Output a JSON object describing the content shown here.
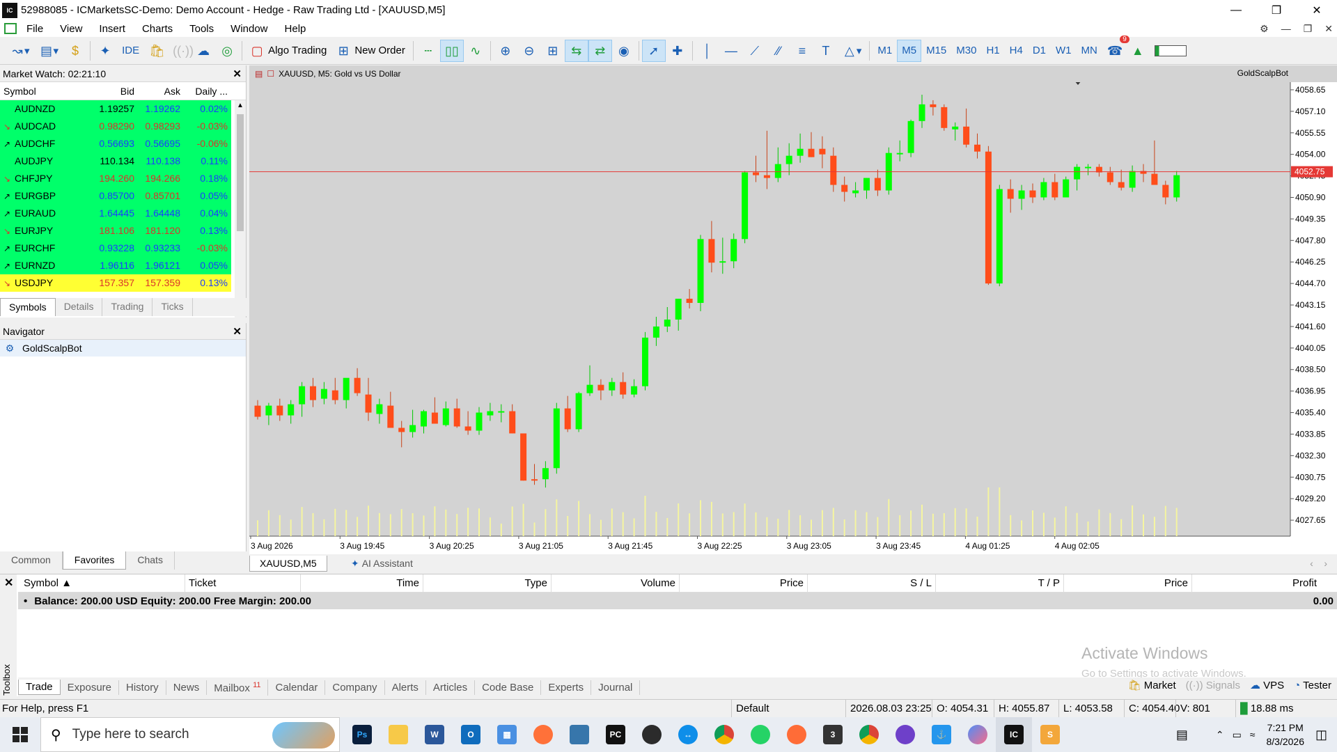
{
  "window": {
    "title": "52988085 - ICMarketsSC-Demo: Demo Account - Hedge - Raw Trading Ltd - [XAUUSD,M5]",
    "logo": "IC"
  },
  "menu": [
    "File",
    "View",
    "Insert",
    "Charts",
    "Tools",
    "Window",
    "Help"
  ],
  "toolbar": {
    "ide": "IDE",
    "algo_trading": "Algo Trading",
    "new_order": "New Order",
    "timeframes": [
      "M1",
      "M5",
      "M15",
      "M30",
      "H1",
      "H4",
      "D1",
      "W1",
      "MN"
    ],
    "active_timeframe": "M5",
    "notifications_count": "9"
  },
  "market_watch": {
    "title": "Market Watch: 02:21:10",
    "columns": [
      "Symbol",
      "Bid",
      "Ask",
      "Daily ..."
    ],
    "rows": [
      {
        "symbol": "AUDNZD",
        "bid": "1.19257",
        "ask": "1.19262",
        "daily": "0.02%",
        "dir": "none",
        "bidc": "neutral",
        "askc": "up",
        "dc": "up"
      },
      {
        "symbol": "AUDCAD",
        "bid": "0.98290",
        "ask": "0.98293",
        "daily": "-0.03%",
        "dir": "down",
        "bidc": "down",
        "askc": "down",
        "dc": "down"
      },
      {
        "symbol": "AUDCHF",
        "bid": "0.56693",
        "ask": "0.56695",
        "daily": "-0.06%",
        "dir": "up",
        "bidc": "up",
        "askc": "up",
        "dc": "down"
      },
      {
        "symbol": "AUDJPY",
        "bid": "110.134",
        "ask": "110.138",
        "daily": "0.11%",
        "dir": "none",
        "bidc": "neutral",
        "askc": "up",
        "dc": "up"
      },
      {
        "symbol": "CHFJPY",
        "bid": "194.260",
        "ask": "194.266",
        "daily": "0.18%",
        "dir": "down",
        "bidc": "down",
        "askc": "down",
        "dc": "up"
      },
      {
        "symbol": "EURGBP",
        "bid": "0.85700",
        "ask": "0.85701",
        "daily": "0.05%",
        "dir": "up",
        "bidc": "up",
        "askc": "down",
        "dc": "up"
      },
      {
        "symbol": "EURAUD",
        "bid": "1.64445",
        "ask": "1.64448",
        "daily": "0.04%",
        "dir": "up",
        "bidc": "up",
        "askc": "up",
        "dc": "up"
      },
      {
        "symbol": "EURJPY",
        "bid": "181.106",
        "ask": "181.120",
        "daily": "0.13%",
        "dir": "down",
        "bidc": "down",
        "askc": "down",
        "dc": "up"
      },
      {
        "symbol": "EURCHF",
        "bid": "0.93228",
        "ask": "0.93233",
        "daily": "-0.03%",
        "dir": "up",
        "bidc": "up",
        "askc": "up",
        "dc": "down"
      },
      {
        "symbol": "EURNZD",
        "bid": "1.96116",
        "ask": "1.96121",
        "daily": "0.05%",
        "dir": "up",
        "bidc": "up",
        "askc": "up",
        "dc": "up"
      },
      {
        "symbol": "USDJPY",
        "bid": "157.357",
        "ask": "157.359",
        "daily": "0.13%",
        "dir": "down",
        "bidc": "down",
        "askc": "down",
        "dc": "up",
        "highlight": "yellow"
      }
    ],
    "tabs": [
      "Symbols",
      "Details",
      "Trading",
      "Ticks"
    ]
  },
  "navigator": {
    "title": "Navigator",
    "items": [
      "GoldScalpBot"
    ],
    "tabs": [
      "Common",
      "Favorites",
      "Chats"
    ]
  },
  "chart": {
    "header": "XAUUSD, M5:  Gold vs US Dollar",
    "ea_label": "GoldScalpBot",
    "current_price_label": "4052.75",
    "tab_label": "XAUUSD,M5",
    "ai_assistant": "AI Assistant",
    "colors": {
      "bull": "#00ff00",
      "bear": "#ff4d1a",
      "background": "#d3d3d3",
      "price_line": "#e53935",
      "volume": "#f5f5a0"
    }
  },
  "chart_data": {
    "type": "candlestick",
    "title": "XAUUSD, M5:  Gold vs US Dollar",
    "y_tick_labels": [
      "4058.65",
      "4057.10",
      "4055.55",
      "4054.00",
      "4052.45",
      "4050.90",
      "4049.35",
      "4047.80",
      "4046.25",
      "4044.70",
      "4043.15",
      "4041.60",
      "4040.05",
      "4038.50",
      "4036.95",
      "4035.40",
      "4033.85",
      "4032.30",
      "4030.75",
      "4029.20",
      "4027.65"
    ],
    "x_tick_labels": [
      "3 Aug 2026",
      "3 Aug 19:45",
      "3 Aug 20:25",
      "3 Aug 21:05",
      "3 Aug 21:45",
      "3 Aug 22:25",
      "3 Aug 23:05",
      "3 Aug 23:45",
      "4 Aug 01:25",
      "4 Aug 02:05"
    ],
    "ylim": [
      4026.5,
      4059.2
    ],
    "current_price": 4052.75,
    "ohlc": [
      [
        4035.9,
        4036.3,
        4034.9,
        4035.1
      ],
      [
        4035.2,
        4036.1,
        4034.5,
        4035.9
      ],
      [
        4035.9,
        4036.4,
        4034.8,
        4035.2
      ],
      [
        4035.2,
        4036.3,
        4034.6,
        4036.0
      ],
      [
        4036.0,
        4037.6,
        4035.1,
        4037.3
      ],
      [
        4037.3,
        4037.9,
        4035.8,
        4036.3
      ],
      [
        4036.4,
        4037.6,
        4036.0,
        4037.1
      ],
      [
        4037.0,
        4037.9,
        4036.0,
        4036.3
      ],
      [
        4036.3,
        4037.7,
        4035.7,
        4037.9
      ],
      [
        4037.9,
        4038.6,
        4036.6,
        4036.8
      ],
      [
        4036.7,
        4037.9,
        4034.8,
        4035.4
      ],
      [
        4035.3,
        4036.4,
        4034.6,
        4036.0
      ],
      [
        4035.9,
        4036.9,
        4034.6,
        4034.3
      ],
      [
        4034.3,
        4034.8,
        4032.9,
        4034.0
      ],
      [
        4034.0,
        4035.6,
        4033.6,
        4034.5
      ],
      [
        4034.4,
        4035.6,
        4033.9,
        4035.5
      ],
      [
        4035.4,
        4036.5,
        4034.6,
        4034.6
      ],
      [
        4034.5,
        4036.2,
        4034.4,
        4035.7
      ],
      [
        4035.7,
        4036.4,
        4034.3,
        4034.4
      ],
      [
        4034.4,
        4035.5,
        4033.8,
        4034.1
      ],
      [
        4034.1,
        4035.8,
        4033.8,
        4035.4
      ],
      [
        4035.2,
        4036.1,
        4034.8,
        4035.5
      ],
      [
        4035.5,
        4036.0,
        4034.7,
        4035.5
      ],
      [
        4035.5,
        4036.0,
        4033.9,
        4033.9
      ],
      [
        4033.9,
        4033.5,
        4030.5,
        4030.5
      ],
      [
        4030.6,
        4031.7,
        4030.2,
        4030.5
      ],
      [
        4030.6,
        4031.9,
        4030.0,
        4031.4
      ],
      [
        4031.4,
        4036.1,
        4031.0,
        4035.7
      ],
      [
        4035.7,
        4036.6,
        4034.0,
        4034.2
      ],
      [
        4034.2,
        4036.9,
        4034.0,
        4036.8
      ],
      [
        4036.8,
        4038.8,
        4036.6,
        4037.4
      ],
      [
        4037.4,
        4037.8,
        4036.3,
        4037.0
      ],
      [
        4037.0,
        4037.9,
        4036.6,
        4037.6
      ],
      [
        4037.6,
        4038.3,
        4036.4,
        4036.7
      ],
      [
        4036.7,
        4037.8,
        4036.5,
        4037.3
      ],
      [
        4037.3,
        4041.2,
        4037.0,
        4040.8
      ],
      [
        4040.8,
        4042.3,
        4040.2,
        4041.6
      ],
      [
        4041.6,
        4043.0,
        4041.2,
        4042.1
      ],
      [
        4042.1,
        4043.6,
        4041.3,
        4043.6
      ],
      [
        4043.6,
        4044.3,
        4042.9,
        4043.3
      ],
      [
        4043.3,
        4048.2,
        4042.7,
        4047.9
      ],
      [
        4047.9,
        4049.2,
        4045.5,
        4046.2
      ],
      [
        4046.2,
        4048.0,
        4045.4,
        4046.3
      ],
      [
        4046.3,
        4048.3,
        4045.8,
        4047.9
      ],
      [
        4047.9,
        4052.8,
        4047.6,
        4052.7
      ],
      [
        4052.7,
        4053.9,
        4052.0,
        4052.5
      ],
      [
        4052.5,
        4055.7,
        4051.5,
        4052.3
      ],
      [
        4052.3,
        4054.5,
        4052.0,
        4053.3
      ],
      [
        4053.3,
        4054.8,
        4052.5,
        4053.9
      ],
      [
        4053.9,
        4055.5,
        4053.4,
        4054.4
      ],
      [
        4054.4,
        4055.6,
        4053.8,
        4053.8
      ],
      [
        4054.4,
        4055.3,
        4053.0,
        4054.0
      ],
      [
        4053.9,
        4054.5,
        4051.3,
        4051.8
      ],
      [
        4051.8,
        4052.4,
        4050.6,
        4051.3
      ],
      [
        4051.2,
        4052.0,
        4050.9,
        4051.4
      ],
      [
        4051.4,
        4052.3,
        4050.8,
        4052.3
      ],
      [
        4052.3,
        4052.9,
        4051.0,
        4051.4
      ],
      [
        4051.4,
        4054.5,
        4051.1,
        4054.1
      ],
      [
        4054.1,
        4055.0,
        4053.5,
        4054.1
      ],
      [
        4054.1,
        4056.5,
        4053.8,
        4056.4
      ],
      [
        4056.4,
        4058.3,
        4055.9,
        4057.6
      ],
      [
        4057.6,
        4057.9,
        4056.8,
        4057.4
      ],
      [
        4057.4,
        4057.6,
        4055.7,
        4055.9
      ],
      [
        4055.8,
        4056.3,
        4055.0,
        4056.0
      ],
      [
        4056.0,
        4057.3,
        4054.5,
        4054.7
      ],
      [
        4054.7,
        4055.5,
        4053.7,
        4054.2
      ],
      [
        4054.2,
        4054.6,
        4044.6,
        4044.7
      ],
      [
        4044.7,
        4051.8,
        4044.5,
        4051.5
      ],
      [
        4051.5,
        4052.2,
        4049.8,
        4050.8
      ],
      [
        4050.8,
        4051.8,
        4050.0,
        4051.4
      ],
      [
        4051.4,
        4051.9,
        4050.5,
        4050.9
      ],
      [
        4050.9,
        4052.3,
        4050.7,
        4052.0
      ],
      [
        4052.0,
        4052.6,
        4050.7,
        4050.9
      ],
      [
        4050.9,
        4052.4,
        4050.9,
        4052.2
      ],
      [
        4052.2,
        4053.3,
        4051.4,
        4053.1
      ],
      [
        4053.1,
        4053.3,
        4052.5,
        4053.1
      ],
      [
        4053.1,
        4053.3,
        4052.4,
        4052.7
      ],
      [
        4052.7,
        4053.1,
        4051.8,
        4052.0
      ],
      [
        4052.0,
        4052.9,
        4051.4,
        4051.6
      ],
      [
        4051.6,
        4053.2,
        4051.3,
        4052.8
      ],
      [
        4052.8,
        4053.3,
        4052.0,
        4052.6
      ],
      [
        4052.6,
        4055.0,
        4051.9,
        4051.8
      ],
      [
        4051.8,
        4052.1,
        4050.4,
        4050.9
      ],
      [
        4050.9,
        4052.8,
        4050.6,
        4052.5
      ]
    ],
    "volume_hint": "volume histogram along bottom"
  },
  "toolbox": {
    "side_label": "Toolbox",
    "columns": [
      "Symbol",
      "Ticket",
      "Time",
      "Type",
      "Volume",
      "Price",
      "S / L",
      "T / P",
      "Price",
      "Profit"
    ],
    "balance_line": "Balance: 200.00 USD  Equity: 200.00  Free Margin: 200.00",
    "profit": "0.00",
    "tabs": [
      "Trade",
      "Exposure",
      "History",
      "News",
      "Mailbox",
      "Calendar",
      "Company",
      "Alerts",
      "Articles",
      "Code Base",
      "Experts",
      "Journal"
    ],
    "mailbox_count": "11",
    "right": [
      "Market",
      "Signals",
      "VPS",
      "Tester"
    ],
    "watermark_title": "Activate Windows",
    "watermark_sub": "Go to Settings to activate Windows."
  },
  "statusbar": {
    "help": "For Help, press F1",
    "profile": "Default",
    "datetime": "2026.08.03 23:25",
    "open": "O: 4054.31",
    "high": "H: 4055.87",
    "low": "L: 4053.58",
    "close": "C: 4054.40",
    "volume": "V: 801",
    "ping": "18.88 ms"
  },
  "taskbar": {
    "search_placeholder": "Type here to search",
    "time": "7:21 PM",
    "date": "8/3/2026"
  }
}
